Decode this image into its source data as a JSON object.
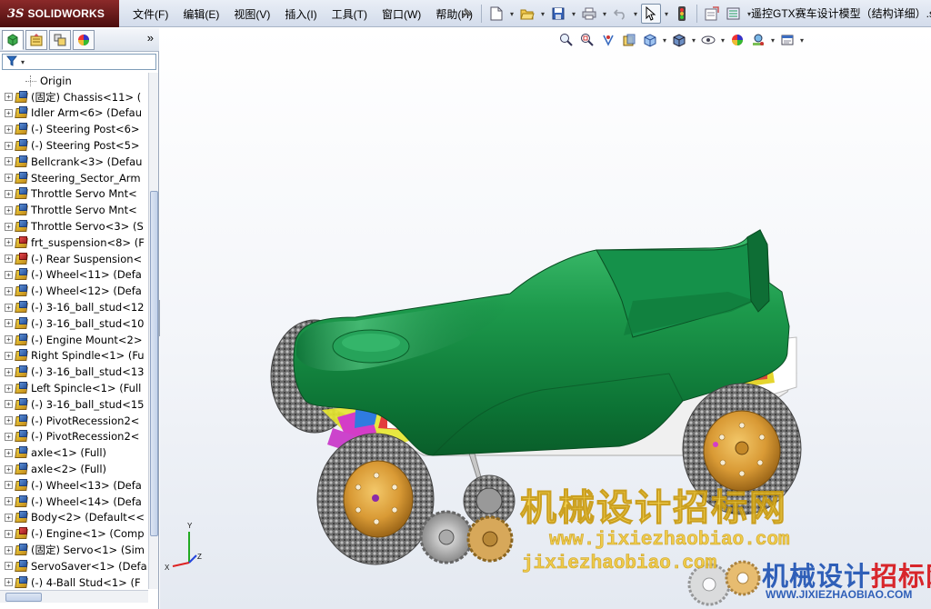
{
  "app": {
    "logo_prefix": "3S",
    "logo_text": "SOLIDWORKS",
    "document_title": "遥控GTX赛车设计模型（结构详细）.sl",
    "accent_color": "#0d6b35"
  },
  "menu": [
    {
      "label": "文件(F)"
    },
    {
      "label": "编辑(E)"
    },
    {
      "label": "视图(V)"
    },
    {
      "label": "插入(I)"
    },
    {
      "label": "工具(T)"
    },
    {
      "label": "窗口(W)"
    },
    {
      "label": "帮助(H)"
    }
  ],
  "toolbar": {
    "icons": [
      "pin-icon",
      "new-document-icon",
      "open-folder-icon",
      "save-icon",
      "print-icon",
      "undo-icon",
      "select-arrow-icon",
      "traffic-light-icon",
      "file-properties-icon",
      "options-icon"
    ]
  },
  "panel": {
    "tabs": [
      "featuremanager-tab",
      "propertymanager-tab",
      "configurationmanager-tab",
      "appearance-tab"
    ],
    "expand_glyph": "»",
    "filter_icon": "filter-icon"
  },
  "tree": {
    "origin_label": "Origin",
    "items": [
      {
        "label": "(固定) Chassis<11> (",
        "icon": "part"
      },
      {
        "label": "Idler Arm<6> (Defau",
        "icon": "part"
      },
      {
        "label": "(-) Steering Post<6>",
        "icon": "part"
      },
      {
        "label": "(-) Steering Post<5>",
        "icon": "part"
      },
      {
        "label": "Bellcrank<3> (Defau",
        "icon": "part"
      },
      {
        "label": "Steering_Sector_Arm",
        "icon": "part"
      },
      {
        "label": "Throttle Servo Mnt<",
        "icon": "part"
      },
      {
        "label": "Throttle Servo Mnt<",
        "icon": "part"
      },
      {
        "label": "Throttle Servo<3> (S",
        "icon": "part"
      },
      {
        "label": "frt_suspension<8> (F",
        "icon": "asm"
      },
      {
        "label": "(-) Rear Suspension<",
        "icon": "asm"
      },
      {
        "label": "(-) Wheel<11> (Defa",
        "icon": "part"
      },
      {
        "label": "(-) Wheel<12> (Defa",
        "icon": "part"
      },
      {
        "label": "(-) 3-16_ball_stud<12",
        "icon": "part"
      },
      {
        "label": "(-) 3-16_ball_stud<10",
        "icon": "part"
      },
      {
        "label": "(-) Engine Mount<2>",
        "icon": "part"
      },
      {
        "label": "Right Spindle<1> (Fu",
        "icon": "part"
      },
      {
        "label": "(-) 3-16_ball_stud<13",
        "icon": "part"
      },
      {
        "label": "Left Spincle<1> (Full",
        "icon": "part"
      },
      {
        "label": "(-) 3-16_ball_stud<15",
        "icon": "part"
      },
      {
        "label": "(-) PivotRecession2<",
        "icon": "part"
      },
      {
        "label": "(-) PivotRecession2<",
        "icon": "part"
      },
      {
        "label": "axle<1> (Full)",
        "icon": "part"
      },
      {
        "label": "axle<2> (Full)",
        "icon": "part"
      },
      {
        "label": "(-) Wheel<13> (Defa",
        "icon": "part"
      },
      {
        "label": "(-) Wheel<14> (Defa",
        "icon": "part"
      },
      {
        "label": "Body<2> (Default<<",
        "icon": "part"
      },
      {
        "label": "(-) Engine<1> (Comp",
        "icon": "asm"
      },
      {
        "label": "(固定) Servo<1> (Sim",
        "icon": "part"
      },
      {
        "label": "ServoSaver<1> (Defa",
        "icon": "part"
      },
      {
        "label": "(-) 4-Ball Stud<1> (F",
        "icon": "part"
      }
    ]
  },
  "headsup": {
    "icons": [
      "zoom-to-fit-icon",
      "zoom-to-area-icon",
      "previous-view-icon",
      "section-view-icon",
      "view-orientation-icon",
      "display-style-icon",
      "hide-show-items-icon",
      "edit-appearance-icon",
      "apply-scene-icon",
      "view-settings-icon"
    ]
  },
  "triad": {
    "x": "X",
    "y": "Y",
    "z": "Z"
  },
  "watermark": {
    "big": "机械设计招标网",
    "url1": "www.jixiezhaobiao.com",
    "url2": "jixiezhaobiao.com",
    "logo_part1": "机械设计",
    "logo_part2": "招标网",
    "logo_url": "WWW.JIXIEZHAOBIAO.COM"
  }
}
